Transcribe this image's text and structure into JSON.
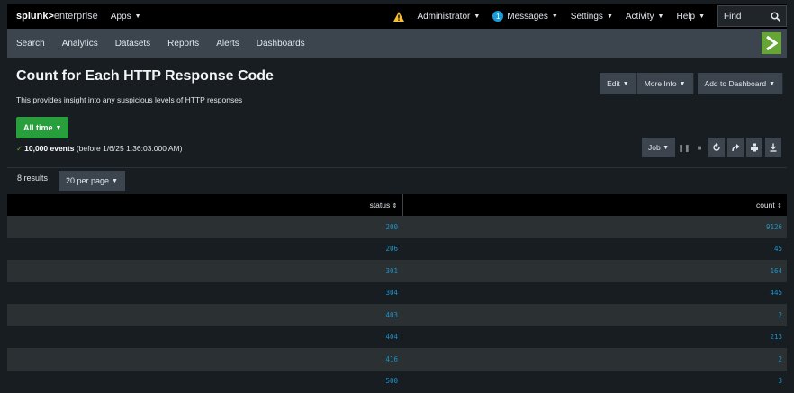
{
  "topbar": {
    "logo_main": "splunk>",
    "logo_sub": "enterprise",
    "apps": "Apps",
    "user": "Administrator",
    "messages_count": "1",
    "messages": "Messages",
    "settings": "Settings",
    "activity": "Activity",
    "help": "Help",
    "find": "Find"
  },
  "nav": [
    "Search",
    "Analytics",
    "Datasets",
    "Reports",
    "Alerts",
    "Dashboards"
  ],
  "header": {
    "title": "Count for Each HTTP Response Code",
    "description": "This provides insight into any suspicious levels of HTTP responses",
    "edit": "Edit",
    "more_info": "More Info",
    "add_to_dashboard": "Add to Dashboard",
    "time_range": "All time",
    "events_bold": "10,000 events",
    "events_rest": "(before 1/6/25 1:36:03.000 AM)",
    "job": "Job"
  },
  "results": {
    "count": "8 results",
    "per_page": "20 per page"
  },
  "table": {
    "col_status": "status",
    "col_count": "count",
    "rows": [
      {
        "status": "200",
        "count": "9126"
      },
      {
        "status": "206",
        "count": "45"
      },
      {
        "status": "301",
        "count": "164"
      },
      {
        "status": "304",
        "count": "445"
      },
      {
        "status": "403",
        "count": "2"
      },
      {
        "status": "404",
        "count": "213"
      },
      {
        "status": "416",
        "count": "2"
      },
      {
        "status": "500",
        "count": "3"
      }
    ]
  },
  "colors": {
    "accent_green": "#65a637",
    "button_green": "#289e3d",
    "link_blue": "#1e93c6",
    "warning_yellow": "#f8be34"
  }
}
